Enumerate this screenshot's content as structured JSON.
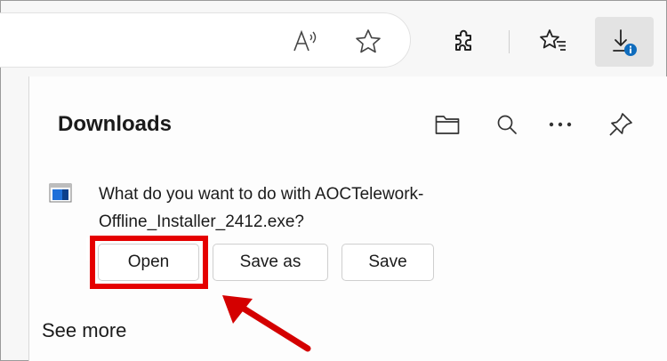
{
  "toolbar": {
    "icons": [
      "read-aloud-icon",
      "favorite-star-icon",
      "extensions-icon",
      "favorites-icon",
      "downloads-icon"
    ],
    "downloads_badge": "i"
  },
  "panel": {
    "title": "Downloads",
    "header_icons": [
      "folder-icon",
      "search-icon",
      "more-icon",
      "pin-icon"
    ],
    "more_label": "···",
    "item": {
      "question": "What do you want to do with AOCTelework-Offline_Installer_2412.exe?",
      "buttons": {
        "open": "Open",
        "save_as": "Save as",
        "save": "Save"
      }
    },
    "see_more": "See more"
  },
  "colors": {
    "highlight": "#e50000",
    "badge": "#0f6cbd"
  }
}
